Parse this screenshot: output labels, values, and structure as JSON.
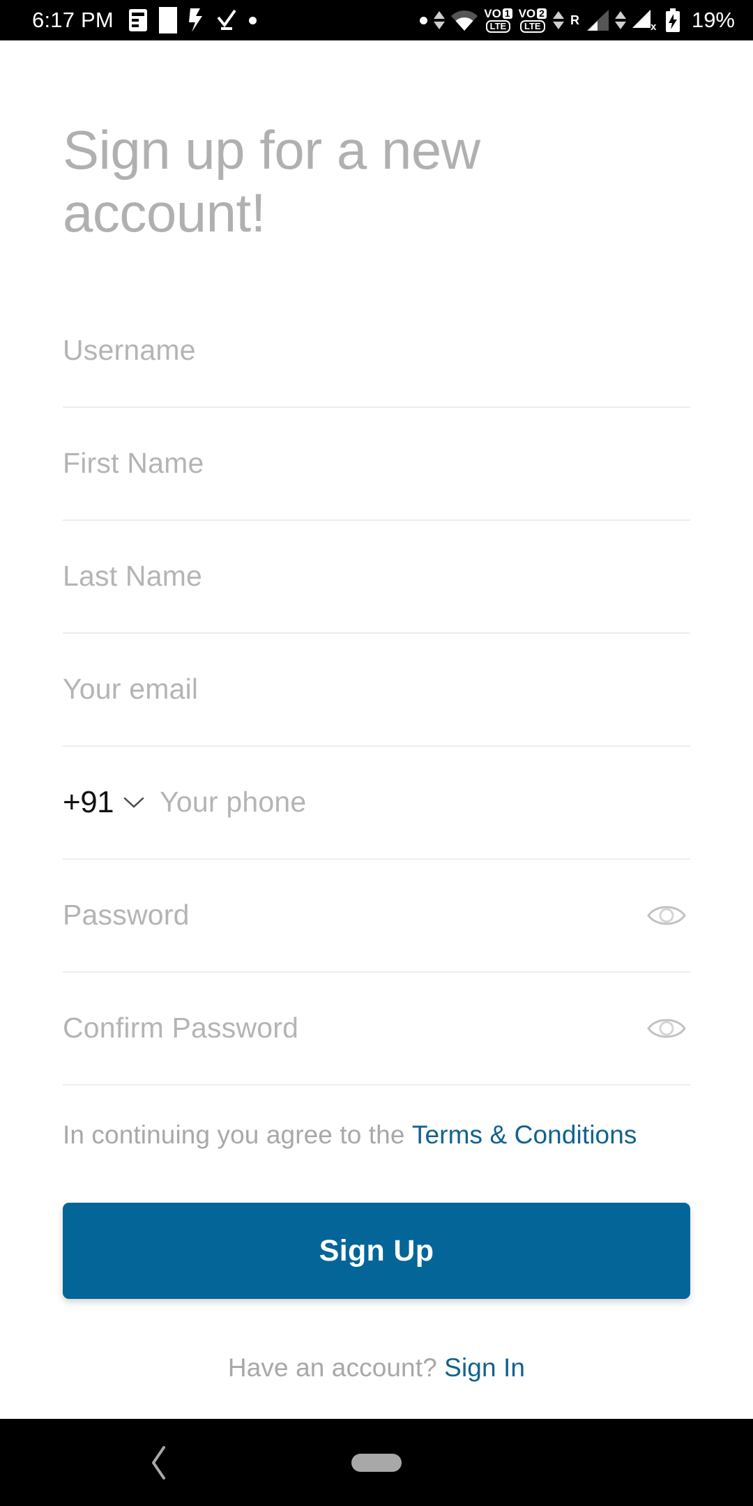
{
  "status_bar": {
    "time": "6:17 PM",
    "battery_percent": "19%",
    "roaming_label": "R",
    "volte_1": {
      "vo": "VO",
      "sim": "1",
      "lte": "LTE"
    },
    "volte_2": {
      "vo": "VO",
      "sim": "2",
      "lte": "LTE"
    },
    "icons": [
      "notification-list-icon",
      "white-square-icon",
      "app-notification-icon",
      "checkmark-icon",
      "dot-icon",
      "dot-icon",
      "data-transfer-arrows-icon",
      "wifi-icon",
      "volte-sim1-icon",
      "volte-sim2-icon",
      "data-transfer-arrows-icon",
      "signal-roaming-icon",
      "data-transfer-arrows-icon",
      "signal-no-service-icon",
      "battery-charging-icon"
    ]
  },
  "screen": {
    "title": "Sign up for a new account!"
  },
  "form": {
    "username": {
      "placeholder": "Username",
      "value": ""
    },
    "first_name": {
      "placeholder": "First Name",
      "value": ""
    },
    "last_name": {
      "placeholder": "Last Name",
      "value": ""
    },
    "email": {
      "placeholder": "Your email",
      "value": ""
    },
    "phone": {
      "country_code": "+91",
      "placeholder": "Your phone",
      "value": ""
    },
    "password": {
      "placeholder": "Password",
      "value": ""
    },
    "confirm_password": {
      "placeholder": "Confirm Password",
      "value": ""
    }
  },
  "terms": {
    "prefix": "In continuing you agree to the ",
    "link": "Terms & Conditions"
  },
  "actions": {
    "signup_label": "Sign Up"
  },
  "footer": {
    "prompt": "Have an account? ",
    "link": "Sign In"
  },
  "colors": {
    "primary_blue": "#046599",
    "link_blue": "#11628f",
    "placeholder_gray": "#b4b4b4",
    "title_gray": "#b0b0b0",
    "underline_gray": "#ededed",
    "background": "#ffffff",
    "system_bar": "#000000"
  },
  "nav_bar": {
    "back_label": "Back",
    "home_label": "Home"
  }
}
